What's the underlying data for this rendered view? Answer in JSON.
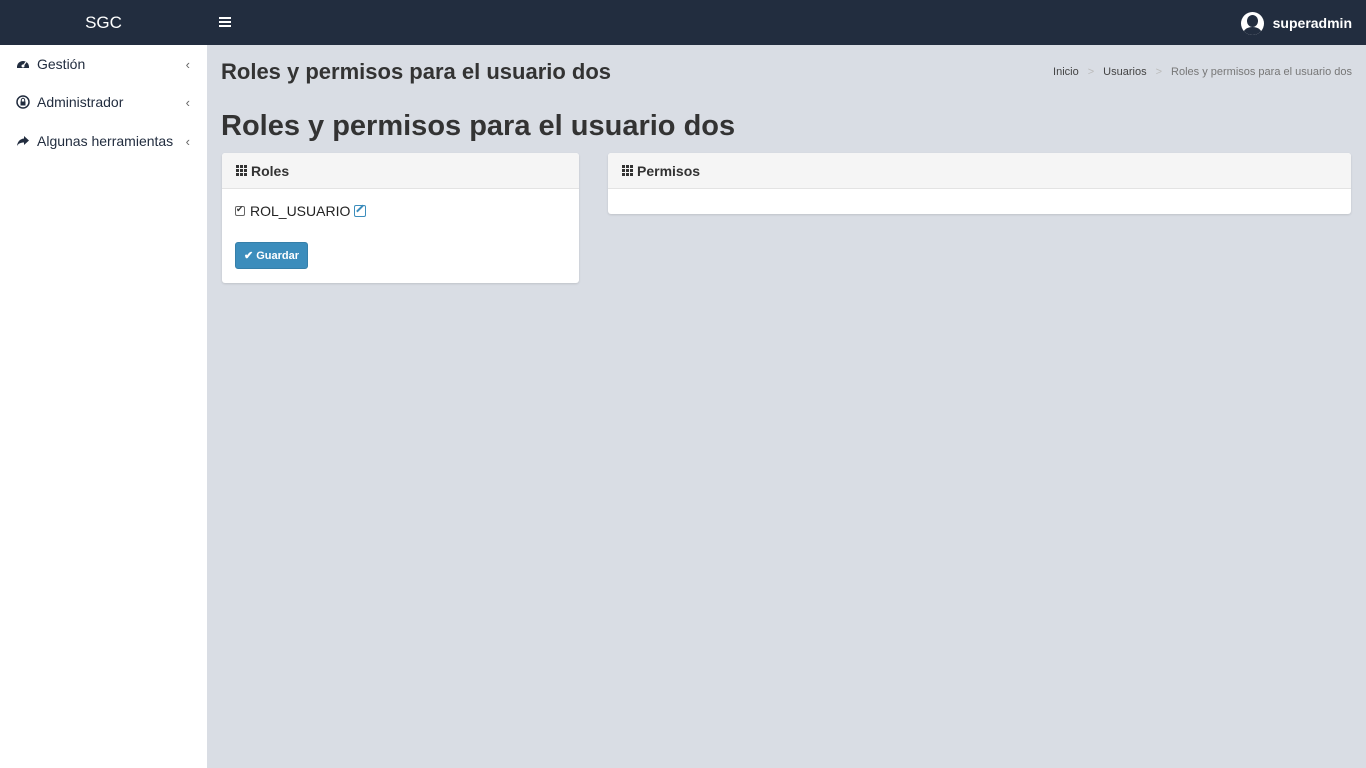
{
  "navbar": {
    "brand": "SGC",
    "username": "superadmin"
  },
  "sidebar": {
    "items": [
      {
        "label": "Gestión",
        "icon": "dashboard-icon"
      },
      {
        "label": "Administrador",
        "icon": "lock-icon"
      },
      {
        "label": "Algunas herramientas",
        "icon": "share-icon"
      }
    ]
  },
  "header": {
    "title": "Roles y permisos para el usuario dos",
    "breadcrumb": {
      "home": "Inicio",
      "users": "Usuarios",
      "current": "Roles y permisos para el usuario dos",
      "separator": ">"
    }
  },
  "main": {
    "title": "Roles y permisos para el usuario dos",
    "roles_panel": {
      "title": "Roles",
      "roles": [
        {
          "label": "ROL_USUARIO",
          "checked": true
        }
      ],
      "save_label": "Guardar"
    },
    "permissions_panel": {
      "title": "Permisos"
    }
  },
  "colors": {
    "navbar": "#222d3f",
    "content_bg": "#d9dde4",
    "primary": "#3c8dbc"
  }
}
